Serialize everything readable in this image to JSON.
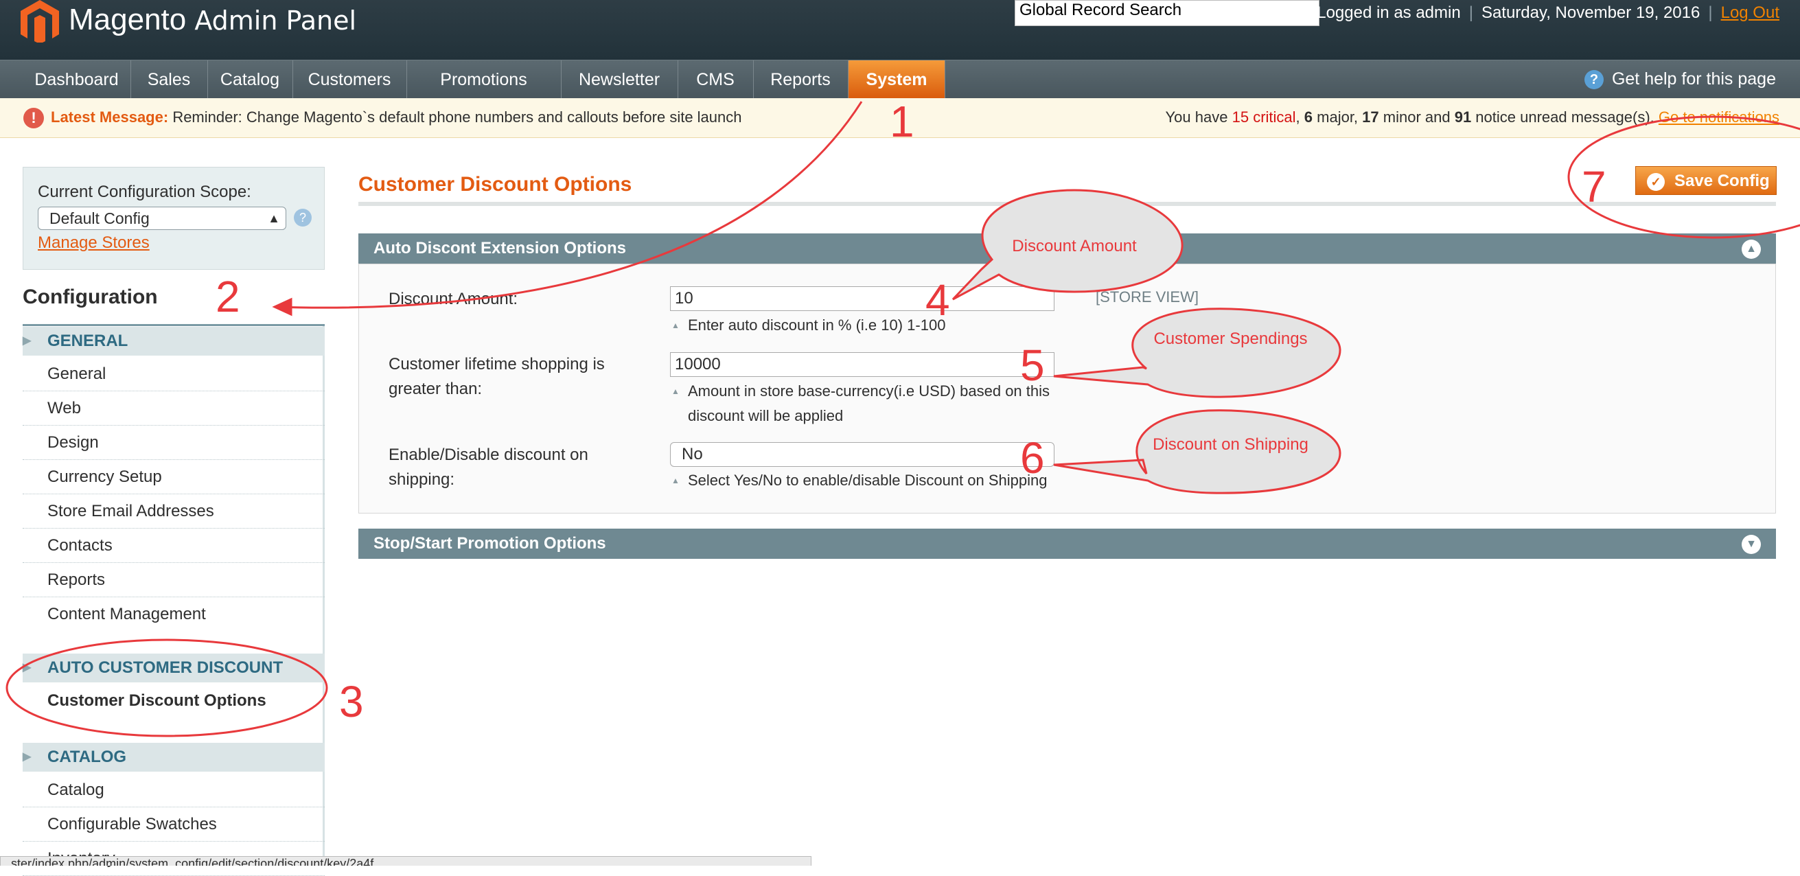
{
  "header": {
    "logo_main": "Magento",
    "logo_sub": "Admin Panel",
    "search_value": "Global Record Search",
    "logged_in": "Logged in as admin",
    "date": "Saturday, November 19, 2016",
    "logout": "Log Out"
  },
  "nav": {
    "items": [
      "Dashboard",
      "Sales",
      "Catalog",
      "Customers",
      "Promotions",
      "Newsletter",
      "CMS",
      "Reports",
      "System"
    ],
    "active": "System",
    "help": "Get help for this page"
  },
  "message": {
    "prefix": "Latest Message:",
    "text": "Reminder: Change Magento`s default phone numbers and callouts before site launch",
    "summary_pre": "You have",
    "critical": "15 critical",
    "major": "6",
    "minor": "17",
    "notice": "91",
    "link": "Go to notifications"
  },
  "sidebar": {
    "scope_label": "Current Configuration Scope:",
    "scope_value": "Default Config",
    "manage_stores": "Manage Stores",
    "config_title": "Configuration",
    "sections": [
      {
        "title": "GENERAL",
        "items": [
          "General",
          "Web",
          "Design",
          "Currency Setup",
          "Store Email Addresses",
          "Contacts",
          "Reports",
          "Content Management"
        ]
      },
      {
        "title": "AUTO CUSTOMER DISCOUNT",
        "items": [
          "Customer Discount Options"
        ]
      },
      {
        "title": "CATALOG",
        "items": [
          "Catalog",
          "Configurable Swatches",
          "Inventory"
        ]
      }
    ]
  },
  "main": {
    "title": "Customer Discount Options",
    "save_label": "Save Config",
    "group1": "Auto Discont Extension Options",
    "group2": "Stop/Start Promotion Options",
    "fields": [
      {
        "label": "Discount Amount:",
        "value": "10",
        "note": "Enter auto discount in % (i.e 10) 1-100",
        "scope": "[STORE VIEW]"
      },
      {
        "label": "Customer lifetime shopping is greater than:",
        "value": "10000",
        "note": "Amount in store base-currency(i.e USD) based on this discount will be applied",
        "scope": ""
      },
      {
        "label": "Enable/Disable discount on shipping:",
        "value": "No",
        "note": "Select Yes/No to enable/disable Discount on Shipping",
        "scope": ""
      }
    ]
  },
  "status_bar": "...ster/index.php/admin/system_config/edit/section/discount/key/2a4f...",
  "annotations": {
    "numbers": [
      "1",
      "2",
      "3",
      "4",
      "5",
      "6",
      "7"
    ],
    "bubbles": [
      "Discount Amount",
      "Customer Spendings",
      "Discount on Shipping"
    ],
    "color": "#e8393c"
  },
  "colors": {
    "accent": "#e35b12",
    "header_bg": "#2e3d45",
    "nav_bg": "#5c6a71",
    "bar_bg": "#6f8992"
  }
}
